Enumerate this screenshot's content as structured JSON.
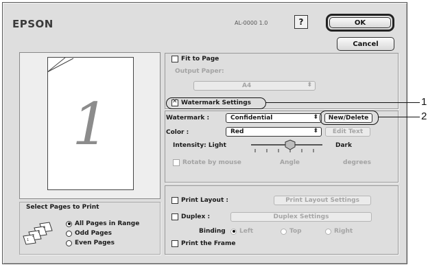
{
  "header": {
    "brand": "EPSON",
    "model": "AL-0000 1.0",
    "help_label": "?",
    "ok_label": "OK",
    "cancel_label": "Cancel"
  },
  "preview": {
    "page_number": "1"
  },
  "fit": {
    "fit_to_page_label": "Fit to Page",
    "output_paper_label": "Output Paper:",
    "output_paper_value": "A4"
  },
  "watermark": {
    "settings_label": "Watermark Settings",
    "watermark_label": "Watermark :",
    "watermark_value": "Confidential",
    "new_delete_label": "New/Delete",
    "color_label": "Color :",
    "color_value": "Red",
    "edit_text_label": "Edit Text",
    "intensity_label": "Intensity: Light",
    "dark_label": "Dark",
    "rotate_label": "Rotate by mouse",
    "angle_label": "Angle",
    "degrees_label": "degrees"
  },
  "layout": {
    "print_layout_label": "Print Layout :",
    "print_layout_settings_label": "Print Layout Settings",
    "duplex_label": "Duplex :",
    "duplex_settings_label": "Duplex Settings",
    "binding_label": "Binding",
    "binding_options": [
      "Left",
      "Top",
      "Right"
    ],
    "print_frame_label": "Print the Frame"
  },
  "select_pages": {
    "title": "Select Pages to Print",
    "options": [
      "All Pages in Range",
      "Odd Pages",
      "Even Pages"
    ]
  },
  "callouts": {
    "one": "1",
    "two": "2"
  },
  "icons": {
    "help": "help-icon",
    "popup": "updown-arrows-icon",
    "pages": "pages-stack-icon"
  }
}
